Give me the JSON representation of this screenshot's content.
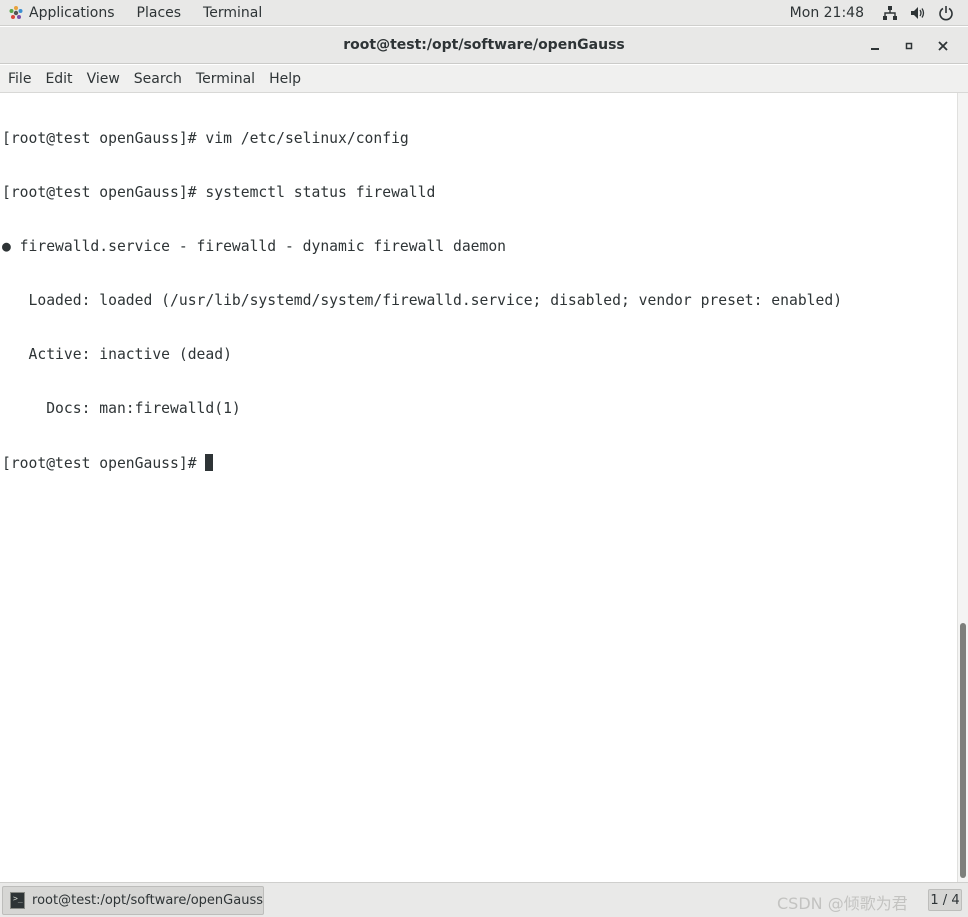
{
  "topbar": {
    "applications_label": "Applications",
    "places_label": "Places",
    "terminal_label": "Terminal",
    "clock": "Mon 21:48",
    "icons": [
      "network-icon",
      "volume-icon",
      "power-icon"
    ]
  },
  "window": {
    "title": "root@test:/opt/software/openGauss",
    "controls": [
      "minimize-icon",
      "maximize-icon",
      "close-icon"
    ]
  },
  "menubar": {
    "items": [
      "File",
      "Edit",
      "View",
      "Search",
      "Terminal",
      "Help"
    ]
  },
  "terminal": {
    "lines": [
      "[root@test openGauss]# vim /etc/selinux/config",
      "[root@test openGauss]# systemctl status firewalld",
      "● firewalld.service - firewalld - dynamic firewall daemon",
      "   Loaded: loaded (/usr/lib/systemd/system/firewalld.service; disabled; vendor preset: enabled)",
      "   Active: inactive (dead)",
      "     Docs: man:firewalld(1)"
    ],
    "prompt": "[root@test openGauss]# "
  },
  "taskbar": {
    "task_label": "root@test:/opt/software/openGauss",
    "watermark": "CSDN @倾歌为君",
    "workspace": "1 / 4"
  },
  "colors": {
    "panel_bg": "#e8e8e7",
    "terminal_fg": "#2e3436",
    "terminal_bg": "#ffffff"
  }
}
